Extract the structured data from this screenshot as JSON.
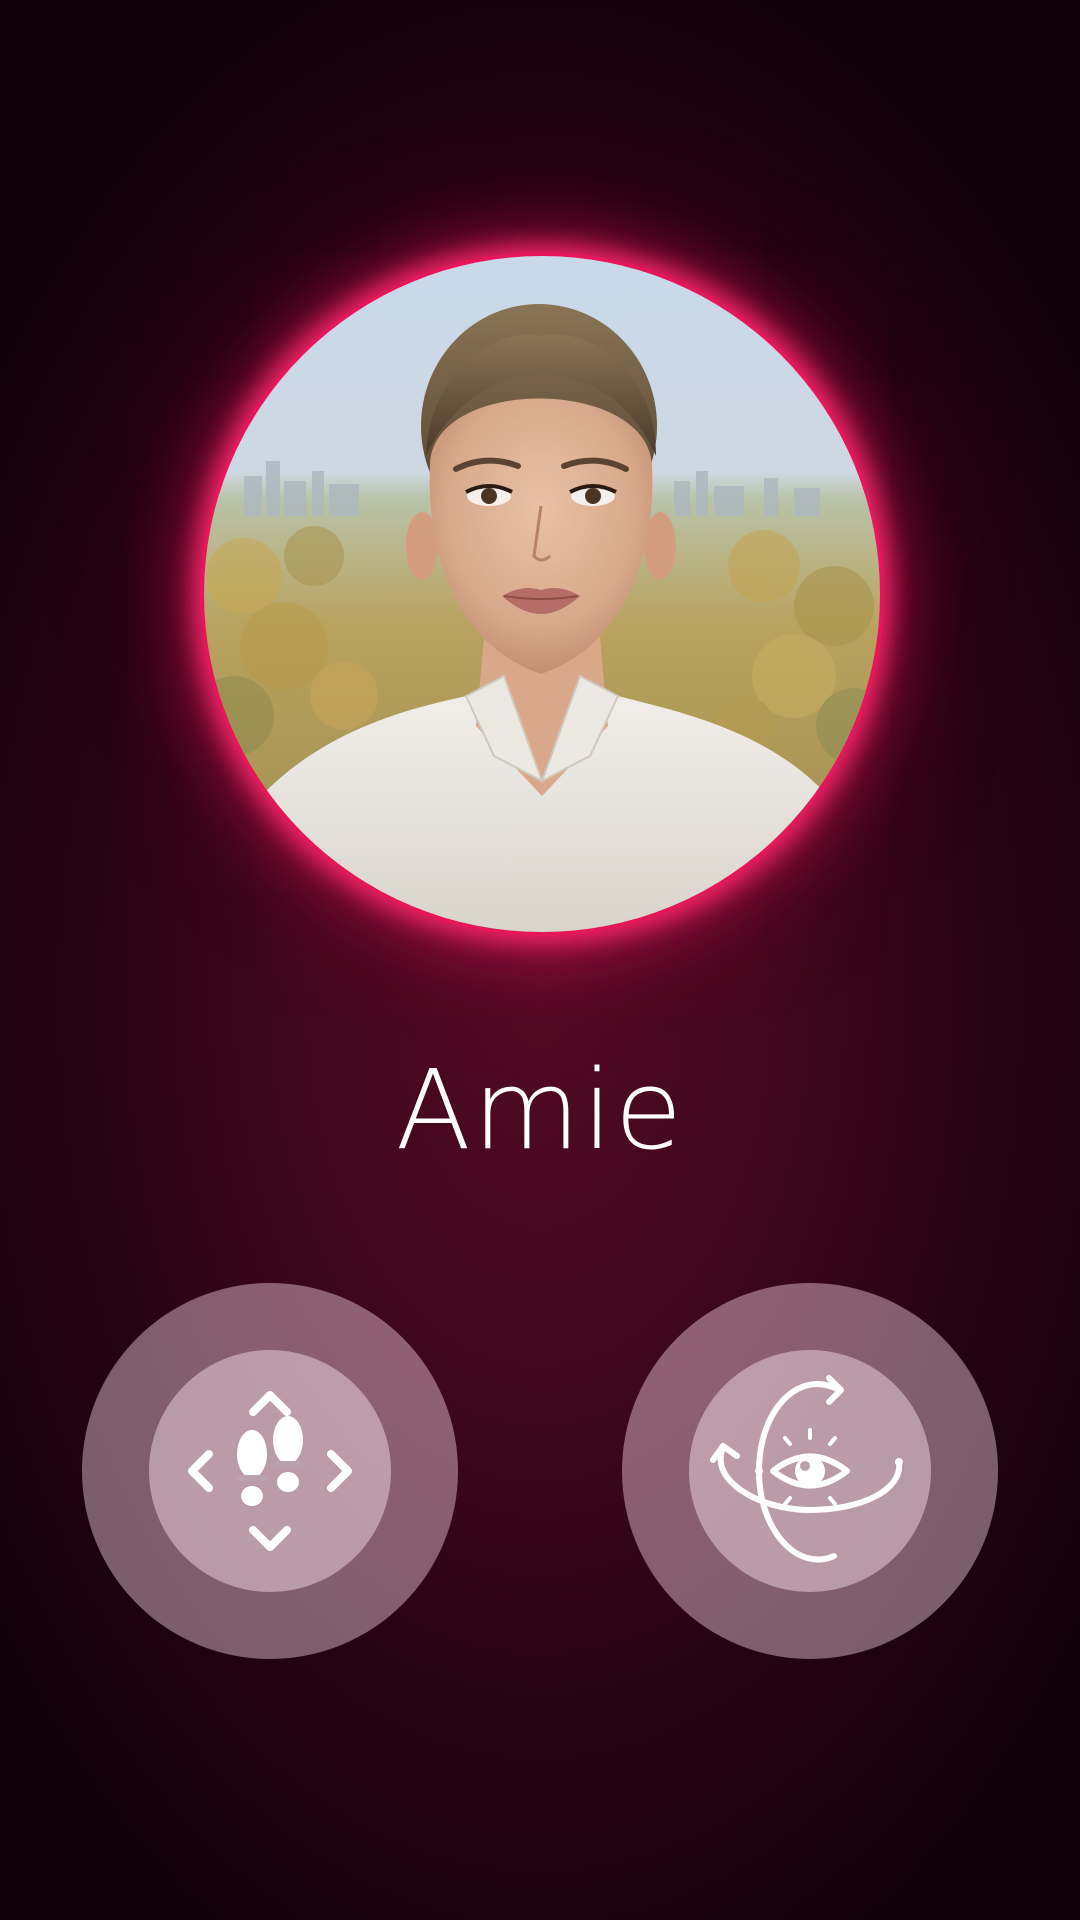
{
  "profile": {
    "name": "Amie",
    "avatar_icon": "portrait-avatar"
  },
  "controls": {
    "move": {
      "icon": "footsteps-move-icon"
    },
    "look": {
      "icon": "eye-rotate-icon"
    }
  },
  "colors": {
    "ring": "#e5175a",
    "background": "#3f071c",
    "text": "#ffffff"
  }
}
